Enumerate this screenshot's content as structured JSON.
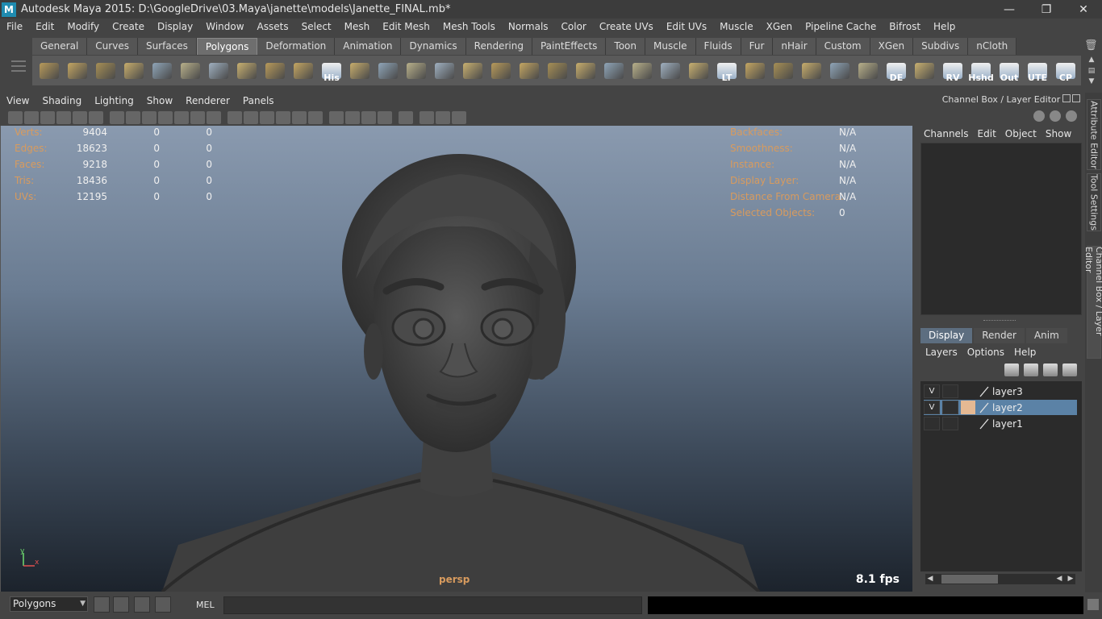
{
  "title": "Autodesk Maya 2015: D:\\GoogleDrive\\03.Maya\\janette\\models\\Janette_FINAL.mb*",
  "logo_letter": "M",
  "window_controls": {
    "minimize": "—",
    "restore": "❐",
    "close": "✕"
  },
  "menus": [
    "File",
    "Edit",
    "Modify",
    "Create",
    "Display",
    "Window",
    "Assets",
    "Select",
    "Mesh",
    "Edit Mesh",
    "Mesh Tools",
    "Normals",
    "Color",
    "Create UVs",
    "Edit UVs",
    "Muscle",
    "XGen",
    "Pipeline Cache",
    "Bifrost",
    "Help"
  ],
  "shelf_tabs": [
    "General",
    "Curves",
    "Surfaces",
    "Polygons",
    "Deformation",
    "Animation",
    "Dynamics",
    "Rendering",
    "PaintEffects",
    "Toon",
    "Muscle",
    "Fluids",
    "Fur",
    "nHair",
    "Custom",
    "XGen",
    "Subdivs",
    "nCloth"
  ],
  "active_shelf_tab": "Polygons",
  "shelf_tools": [
    {
      "icon": "poly-sphere-icon",
      "label": ""
    },
    {
      "icon": "poly-cube-icon",
      "label": ""
    },
    {
      "icon": "poly-cylinder-icon",
      "label": ""
    },
    {
      "icon": "poly-cone-icon",
      "label": ""
    },
    {
      "icon": "poly-plane-icon",
      "label": ""
    },
    {
      "icon": "poly-torus-icon",
      "label": ""
    },
    {
      "icon": "poly-pyramid-icon",
      "label": ""
    },
    {
      "icon": "poly-pipe-icon",
      "label": ""
    },
    {
      "icon": "create-polygon-icon",
      "label": ""
    },
    {
      "icon": "smooth-icon",
      "label": ""
    },
    {
      "icon": "history-icon",
      "label": "His"
    },
    {
      "icon": "extrude-icon",
      "label": ""
    },
    {
      "icon": "bevel-icon",
      "label": ""
    },
    {
      "icon": "bridge-icon",
      "label": ""
    },
    {
      "icon": "append-icon",
      "label": ""
    },
    {
      "icon": "split-icon",
      "label": ""
    },
    {
      "icon": "merge-icon",
      "label": ""
    },
    {
      "icon": "wedge-icon",
      "label": ""
    },
    {
      "icon": "sculpt-icon",
      "label": ""
    },
    {
      "icon": "paint-icon",
      "label": ""
    },
    {
      "icon": "lattice-icon",
      "label": ""
    },
    {
      "icon": "rotate-manip-icon",
      "label": ""
    },
    {
      "icon": "universal-manip-icon",
      "label": ""
    },
    {
      "icon": "move-icon",
      "label": ""
    },
    {
      "icon": "lt-icon",
      "label": "LT"
    },
    {
      "icon": "uv-layout-icon",
      "label": ""
    },
    {
      "icon": "uv-planar-icon",
      "label": ""
    },
    {
      "icon": "uv-cylindrical-icon",
      "label": ""
    },
    {
      "icon": "uv-spherical-icon",
      "label": ""
    },
    {
      "icon": "uv-auto-icon",
      "label": ""
    },
    {
      "icon": "de-icon",
      "label": "DE"
    },
    {
      "icon": "grid-icon",
      "label": ""
    },
    {
      "icon": "rv-icon",
      "label": "RV"
    },
    {
      "icon": "hshd-icon",
      "label": "Hshd"
    },
    {
      "icon": "out-icon",
      "label": "Out"
    },
    {
      "icon": "ute-icon",
      "label": "UTE"
    },
    {
      "icon": "cp-icon",
      "label": "CP"
    }
  ],
  "panel_menus": [
    "View",
    "Shading",
    "Lighting",
    "Show",
    "Renderer",
    "Panels"
  ],
  "hud_left": [
    {
      "label": "Verts:",
      "v1": "9404",
      "v2": "0",
      "v3": "0"
    },
    {
      "label": "Edges:",
      "v1": "18623",
      "v2": "0",
      "v3": "0"
    },
    {
      "label": "Faces:",
      "v1": "9218",
      "v2": "0",
      "v3": "0"
    },
    {
      "label": "Tris:",
      "v1": "18436",
      "v2": "0",
      "v3": "0"
    },
    {
      "label": "UVs:",
      "v1": "12195",
      "v2": "0",
      "v3": "0"
    }
  ],
  "hud_right": [
    {
      "label": "Backfaces:",
      "value": "N/A"
    },
    {
      "label": "Smoothness:",
      "value": "N/A"
    },
    {
      "label": "Instance:",
      "value": "N/A"
    },
    {
      "label": "Display Layer:",
      "value": "N/A"
    },
    {
      "label": "Distance From Camera:",
      "value": "N/A"
    },
    {
      "label": "Selected Objects:",
      "value": "0"
    }
  ],
  "camera_name": "persp",
  "fps": "8.1 fps",
  "axis": {
    "y": "y",
    "x": "x"
  },
  "right_panel": {
    "title": "Channel Box / Layer Editor",
    "cb_menus": [
      "Channels",
      "Edit",
      "Object",
      "Show"
    ],
    "layer_tabs": [
      "Display",
      "Render",
      "Anim"
    ],
    "active_layer_tab": "Display",
    "layer_menus": [
      "Layers",
      "Options",
      "Help"
    ],
    "layers": [
      {
        "v": "V",
        "name": "layer3",
        "color": "",
        "selected": false
      },
      {
        "v": "V",
        "name": "layer2",
        "color": "#e5b993",
        "selected": true
      },
      {
        "v": "",
        "name": "layer1",
        "color": "",
        "selected": false
      }
    ]
  },
  "side_tabs": [
    "Attribute Editor",
    "Tool Settings",
    "Channel Box / Layer Editor"
  ],
  "command_line": {
    "mode": "Polygons",
    "mel_label": "MEL"
  }
}
